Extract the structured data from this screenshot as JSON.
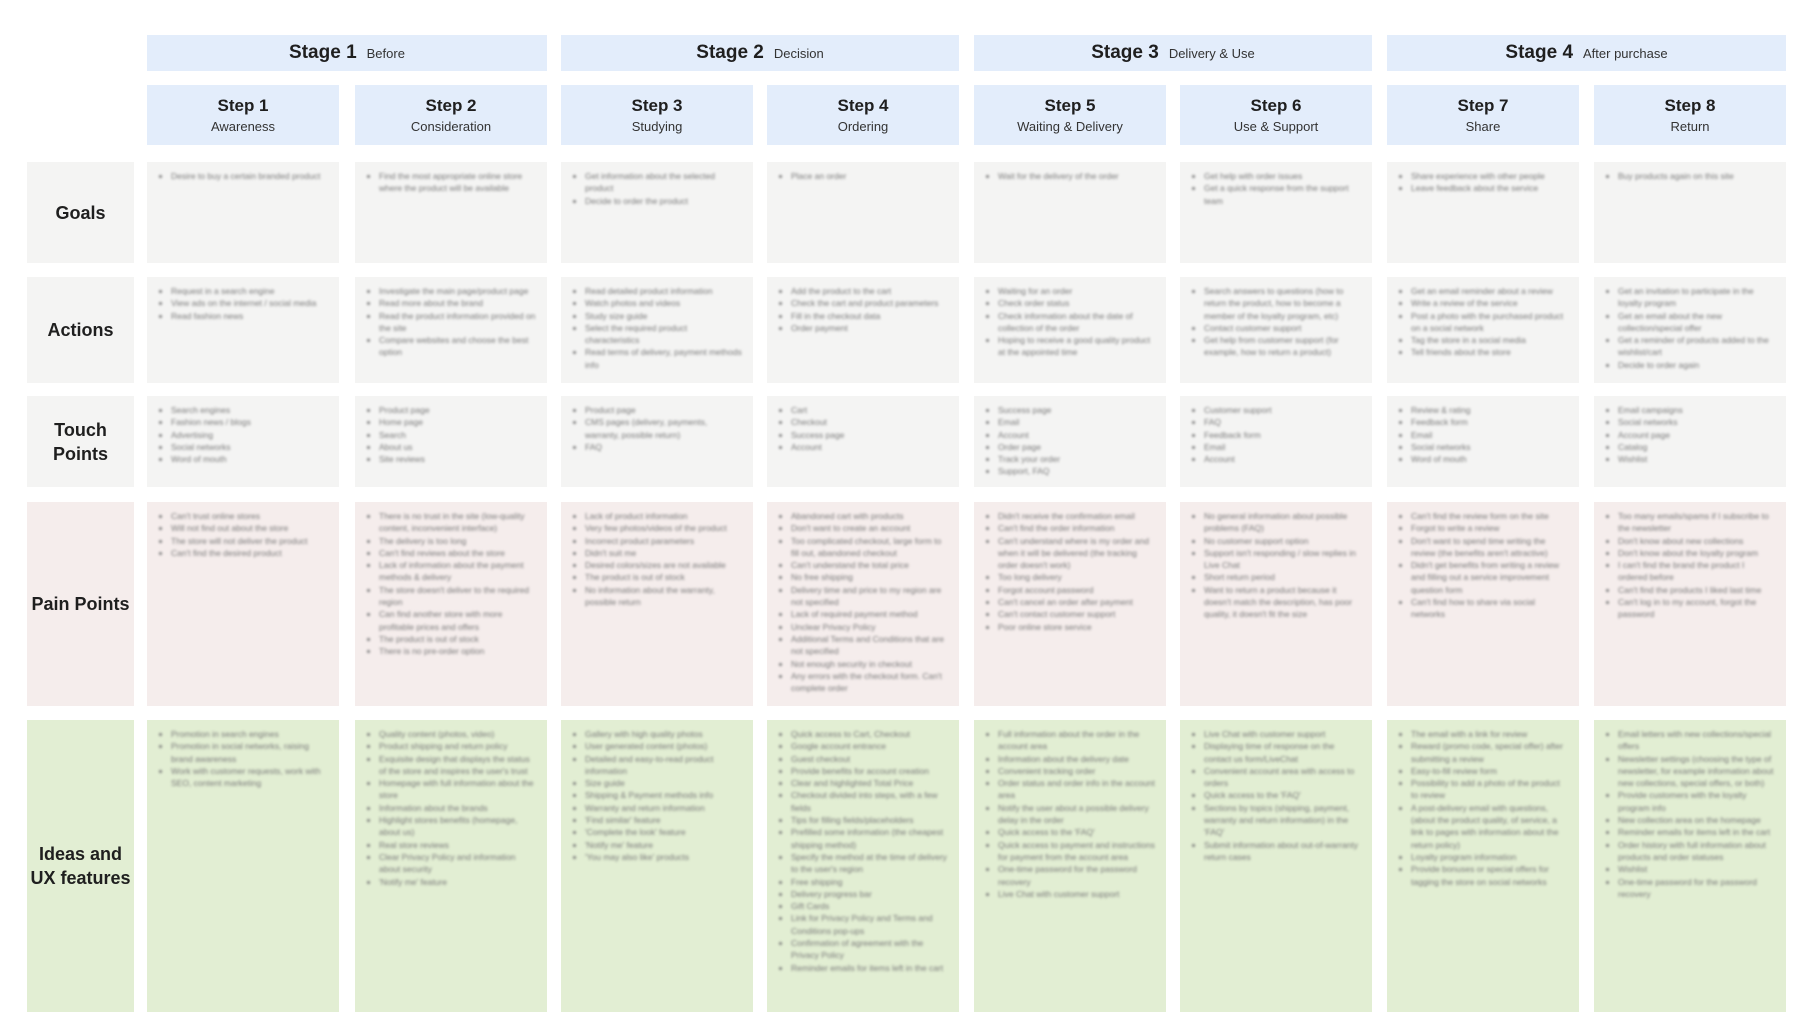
{
  "stages": [
    {
      "title": "Stage 1",
      "subtitle": "Before"
    },
    {
      "title": "Stage 2",
      "subtitle": "Decision"
    },
    {
      "title": "Stage 3",
      "subtitle": "Delivery & Use"
    },
    {
      "title": "Stage 4",
      "subtitle": "After purchase"
    }
  ],
  "steps": [
    {
      "title": "Step 1",
      "subtitle": "Awareness"
    },
    {
      "title": "Step 2",
      "subtitle": "Consideration"
    },
    {
      "title": "Step 3",
      "subtitle": "Studying"
    },
    {
      "title": "Step 4",
      "subtitle": "Ordering"
    },
    {
      "title": "Step 5",
      "subtitle": "Waiting & Delivery"
    },
    {
      "title": "Step 6",
      "subtitle": "Use & Support"
    },
    {
      "title": "Step 7",
      "subtitle": "Share"
    },
    {
      "title": "Step 8",
      "subtitle": "Return"
    }
  ],
  "rows": [
    {
      "label": "Goals",
      "color": "#f4f4f3",
      "cells": [
        [
          "Desire to buy a certain branded product"
        ],
        [
          "Find the most appropriate online store where the product will be available"
        ],
        [
          "Get information about the selected product",
          "Decide to order the product"
        ],
        [
          "Place an order"
        ],
        [
          "Wait for the delivery of the order"
        ],
        [
          "Get help with order issues",
          "Get a quick response from the support team"
        ],
        [
          "Share experience with other people",
          "Leave feedback about the service"
        ],
        [
          "Buy products again on this site"
        ]
      ]
    },
    {
      "label": "Actions",
      "color": "#f4f4f3",
      "cells": [
        [
          "Request in a search engine",
          "View ads on the internet / social media",
          "Read fashion news"
        ],
        [
          "Investigate the main page/product page",
          "Read more about the brand",
          "Read the product information provided on the site",
          "Compare websites and choose the best option"
        ],
        [
          "Read detailed product information",
          "Watch photos and videos",
          "Study size guide",
          "Select the required product characteristics",
          "Read terms of delivery, payment methods info"
        ],
        [
          "Add the product to the cart",
          "Check the cart and product parameters",
          "Fill in the checkout data",
          "Order payment"
        ],
        [
          "Waiting for an order",
          "Check order status",
          "Check information about the date of collection of the order",
          "Hoping to receive a good quality product at the appointed time"
        ],
        [
          "Search answers to questions (how to return the product, how to become a member of the loyalty program, etc)",
          "Contact customer support",
          "Get help from customer support (for example, how to return a product)"
        ],
        [
          "Get an email reminder about a review",
          "Write a review of the service",
          "Post a photo with the purchased product on a social network",
          "Tag the store in a social media",
          "Tell friends about the store"
        ],
        [
          "Get an invitation to participate in the loyalty program",
          "Get an email about the new collection/special offer",
          "Get a reminder of products added to the wishlist/cart",
          "Decide to order again"
        ]
      ]
    },
    {
      "label": "Touch Points",
      "color": "#f4f4f3",
      "cells": [
        [
          "Search engines",
          "Fashion news / blogs",
          "Advertising",
          "Social networks",
          "Word of mouth"
        ],
        [
          "Product page",
          "Home page",
          "Search",
          "About us",
          "Site reviews"
        ],
        [
          "Product page",
          "CMS pages (delivery, payments, warranty, possible return)",
          "FAQ"
        ],
        [
          "Cart",
          "Checkout",
          "Success page",
          "Account"
        ],
        [
          "Success page",
          "Email",
          "Account",
          "Order page",
          "Track your order",
          "Support, FAQ"
        ],
        [
          "Customer support",
          "FAQ",
          "Feedback form",
          "Email",
          "Account"
        ],
        [
          "Review & rating",
          "Feedback form",
          "Email",
          "Social networks",
          "Word of mouth"
        ],
        [
          "Email campaigns",
          "Social networks",
          "Account page",
          "Catalog",
          "Wishlist"
        ]
      ]
    },
    {
      "label": "Pain Points",
      "color": "#f5edec",
      "cells": [
        [
          "Can't trust online stores",
          "Will not find out about the store",
          "The store will not deliver the product",
          "Can't find the desired product"
        ],
        [
          "There is no trust in the site (low-quality content, inconvenient interface)",
          "The delivery is too long",
          "Can't find reviews about the store",
          "Lack of information about the payment methods & delivery",
          "The store doesn't deliver to the required region",
          "Can find another store with more profitable prices and offers",
          "The product is out of stock",
          "There is no pre-order option"
        ],
        [
          "Lack of product information",
          "Very few photos/videos of the product",
          "Incorrect product parameters",
          "Didn't suit me",
          "Desired colors/sizes are not available",
          "The product is out of stock",
          "No information about the warranty, possible return"
        ],
        [
          "Abandoned cart with products",
          "Don't want to create an account",
          "Too complicated checkout, large form to fill out, abandoned checkout",
          "Can't understand the total price",
          "No free shipping",
          "Delivery time and price to my region are not specified",
          "Lack of required payment method",
          "Unclear Privacy Policy",
          "Additional Terms and Conditions that are not specified",
          "Not enough security in checkout",
          "Any errors with the checkout form. Can't complete order"
        ],
        [
          "Didn't receive the confirmation email",
          "Can't find the order information",
          "Can't understand where is my order and when it will be delivered (the tracking order doesn't work)",
          "Too long delivery",
          "Forgot account password",
          "Can't cancel an order after payment",
          "Can't contact customer support",
          "Poor online store service"
        ],
        [
          "No general information about possible problems (FAQ)",
          "No customer support option",
          "Support isn't responding / slow replies in Live Chat",
          "Short return period",
          "Want to return a product because it doesn't match the description, has poor quality, it doesn't fit the size"
        ],
        [
          "Can't find the review form on the site",
          "Forgot to write a review",
          "Don't want to spend time writing the review (the benefits aren't attractive)",
          "Didn't get benefits from writing a review and filling out a service improvement question form",
          "Can't find how to share via social networks"
        ],
        [
          "Too many emails/spams if I subscribe to the newsletter",
          "Don't know about new collections",
          "Don't know about the loyalty program",
          "I can't find the brand the product I ordered before",
          "Can't find the products I liked last time",
          "Can't log in to my account, forgot the password"
        ]
      ]
    },
    {
      "label": "Ideas and UX features",
      "color": "#e2eed3",
      "cells": [
        [
          "Promotion in search engines",
          "Promotion in social networks, raising brand awareness",
          "Work with customer requests, work with SEO, content marketing"
        ],
        [
          "Quality content (photos, video)",
          "Product shipping and return policy",
          "Exquisite design that displays the status of the store and inspires the user's trust",
          "Homepage with full information about the store",
          "Information about the brands",
          "Highlight stores benefits (homepage, about us)",
          "Real store reviews",
          "Clear Privacy Policy and information about security",
          "'Notify me' feature"
        ],
        [
          "Gallery with high quality photos",
          "User generated content (photos)",
          "Detailed and easy-to-read product information",
          "Size guide",
          "Shipping & Payment methods info",
          "Warranty and return information",
          "'Find similar' feature",
          "'Complete the look' feature",
          "'Notify me' feature",
          "'You may also like' products"
        ],
        [
          "Quick access to Cart, Checkout",
          "Google account entrance",
          "Guest checkout",
          "Provide benefits for account creation",
          "Clear and highlighted Total Price",
          "Checkout divided into steps, with a few fields",
          "Tips for filling fields/placeholders",
          "Prefilled some information (the cheapest shipping method)",
          "Specify the method at the time of delivery to the user's region",
          "Free shipping",
          "Delivery progress bar",
          "Gift Cards",
          "Link for Privacy Policy and Terms and Conditions pop-ups",
          "Confirmation of agreement with the Privacy Policy",
          "Reminder emails for items left in the cart"
        ],
        [
          "Full information about the order in the account area",
          "Information about the delivery date",
          "Convenient tracking order",
          "Order status and order info in the account area",
          "Notify the user about a possible delivery delay in the order",
          "Quick access to the 'FAQ'",
          "Quick access to payment and instructions for payment from the account area",
          "One-time password for the password recovery",
          "Live Chat with customer support"
        ],
        [
          "Live Chat with customer support",
          "Displaying time of response on the contact us form/LiveChat",
          "Convenient account area with access to orders",
          "Quick access to the 'FAQ'",
          "Sections by topics (shipping, payment, warranty and return information) in the 'FAQ'",
          "Submit information about out-of-warranty return cases"
        ],
        [
          "The email with a link for review",
          "Reward (promo code, special offer) after submitting a review",
          "Easy-to-fill review form",
          "Possibility to add a photo of the product to review",
          "A post-delivery email with questions, (about the product quality, of service, a link to pages with information about the return policy)",
          "Loyalty program information",
          "Provide bonuses or special offers for tagging the store on social networks"
        ],
        [
          "Email letters with new collections/special offers",
          "Newsletter settings (choosing the type of newsletter, for example information about new collections, special offers, or both)",
          "Provide customers with the loyalty program info",
          "New collection area on the homepage",
          "Reminder emails for items left in the cart",
          "Order history with full information about products and order statuses",
          "Wishlist",
          "One-time password for the password recovery"
        ]
      ]
    }
  ]
}
